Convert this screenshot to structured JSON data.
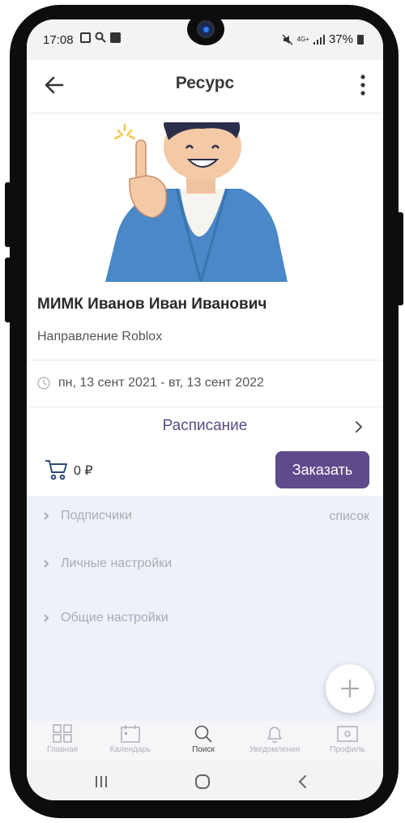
{
  "status_bar": {
    "time": "17:08",
    "network": "4G+",
    "battery": "37%"
  },
  "app_bar": {
    "title": "Ресурс"
  },
  "resource": {
    "name": "МИМК Иванов Иван Иванович",
    "direction": "Направление Roblox",
    "date_range": "пн, 13 сент 2021 - вт, 13 сент 2022",
    "schedule_label": "Расписание"
  },
  "order": {
    "price": "0 ₽",
    "order_button": "Заказать"
  },
  "settings": [
    {
      "label": "Подписчики",
      "value": "список"
    },
    {
      "label": "Личные настройки"
    },
    {
      "label": "Общие настройки"
    }
  ],
  "bottom_nav": [
    {
      "label": "Главная",
      "icon": "grid-icon"
    },
    {
      "label": "Календарь",
      "icon": "calendar-icon"
    },
    {
      "label": "Поиск",
      "icon": "search-icon",
      "active": true
    },
    {
      "label": "Уведомления",
      "icon": "bell-icon"
    },
    {
      "label": "Профиль",
      "icon": "profile-icon"
    }
  ],
  "colors": {
    "accent": "#5f4a8b",
    "schedule_text": "#5a4a86",
    "settings_bg": "#eef1fa"
  }
}
